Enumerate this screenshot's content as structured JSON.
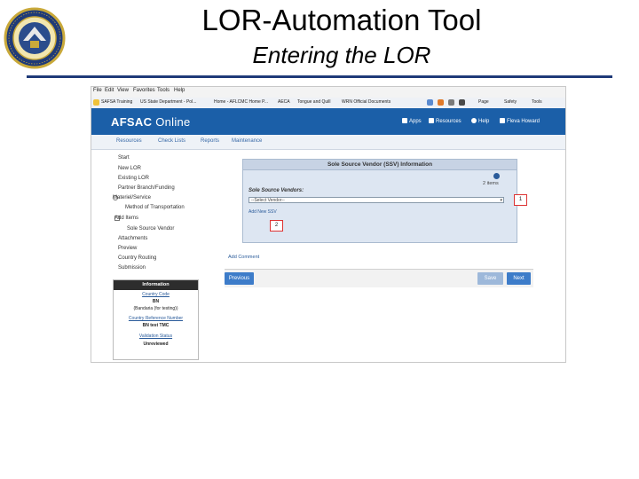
{
  "slide": {
    "title": "LOR-Automation Tool",
    "subtitle": "Entering the LOR"
  },
  "browser": {
    "menu": [
      "File",
      "Edit",
      "View",
      "Favorites",
      "Tools",
      "Help"
    ],
    "favorites": [
      "SAFSA Training",
      "US State Department - Pol...",
      "Home - AFLCMC Home P...",
      "AECA",
      "Tongue and Quill",
      "WRN Official Documents"
    ],
    "toolbar_right": [
      "Page",
      "Safety",
      "Tools"
    ]
  },
  "app": {
    "brand_bold": "AFSAC",
    "brand_thin": " Online",
    "nav": [
      "Apps",
      "Resources",
      "Help",
      "Fleva Howard"
    ],
    "subnav": [
      "Resources",
      "Check Lists",
      "Reports",
      "Maintenance"
    ]
  },
  "tree": [
    "Start",
    "New LOR",
    "Existing LOR",
    "Partner Branch/Funding",
    "Materiel/Service",
    "Method of Transportation",
    "Add Items",
    "Sole Source Vendor",
    "Attachments",
    "Preview",
    "Country Routing",
    "Submission"
  ],
  "info": {
    "header": "Information",
    "country_code_label": "Country Code",
    "country_code_value": "BN",
    "country_code_desc": "(Bandaria (for testing))",
    "crn_label": "Country Reference Number",
    "crn_value": "BN test TMC",
    "validation_label": "Validation Status",
    "validation_value": "Unreviewed"
  },
  "panel": {
    "title": "Sole Source Vendor (SSV) Information",
    "items_count": "2 items",
    "ssv_label": "Sole Source Vendors:",
    "select_value": "--Select Vendor--",
    "add_ssv": "Add New SSV",
    "callout_1": "1",
    "callout_2": "2"
  },
  "page": {
    "add_comment": "Add Comment",
    "previous": "Previous",
    "save": "Save",
    "next": "Next"
  },
  "colors": {
    "appbar": "#1b5fa8",
    "button_blue": "#3d7cc9",
    "button_disabled": "#9db8da",
    "rule": "#1f3a78"
  }
}
